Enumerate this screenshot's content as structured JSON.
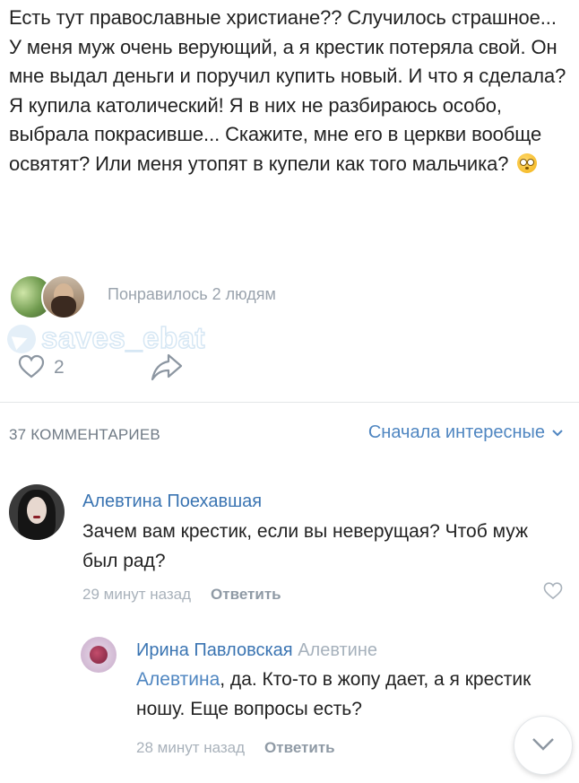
{
  "post": {
    "text": "Есть тут православные христиане?? Случилось страшное... У меня муж очень верующий, а я крестик потеряла свой. Он мне выдал деньги и поручил купить новый. И что я сделала? Я купила католический! Я в них не разбираюсь особо, выбрала покрасивше... Скажите, мне его в церкви вообще освятят? Или меня утопят в купели как того мальчика?",
    "emoji": "flushed-face-emoji",
    "likes_text": "Понравилось 2 людям",
    "like_count": "2"
  },
  "watermark": {
    "text": "saves_ebat"
  },
  "comments_header": {
    "count_label": "37 КОММЕНТАРИЕВ",
    "sort_label": "Сначала интересные"
  },
  "comments": [
    {
      "author": "Алевтина Поехавшая",
      "text": "Зачем вам крестик, если вы неверущая? Чтоб муж был рад?",
      "time": "29 минут назад",
      "reply_label": "Ответить"
    },
    {
      "author": "Ирина Павловская",
      "reply_to": "Алевтине",
      "mention": "Алевтина",
      "text": ", да. Кто-то в жопу дает, а я крестик ношу. Еще вопросы есть?",
      "time": "28 минут назад",
      "reply_label": "Ответить"
    }
  ],
  "colors": {
    "link": "#3a74b2",
    "muted": "#a9b2bb",
    "accent": "#4f86c1"
  },
  "icons": [
    "heart-icon",
    "share-icon",
    "chevron-down-icon",
    "telegram-icon"
  ]
}
